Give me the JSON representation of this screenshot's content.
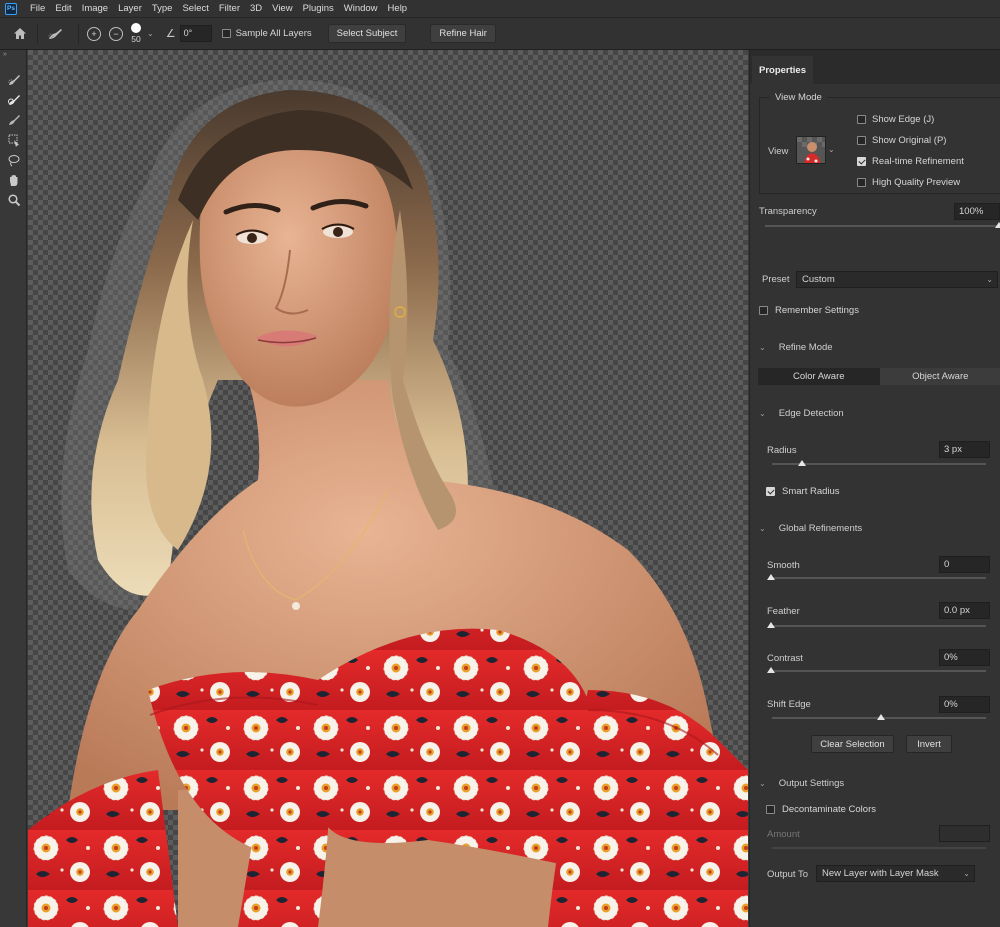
{
  "app": {
    "logo_text": "Ps"
  },
  "menu": [
    "File",
    "Edit",
    "Image",
    "Layer",
    "Type",
    "Select",
    "Filter",
    "3D",
    "View",
    "Plugins",
    "Window",
    "Help"
  ],
  "options_bar": {
    "brush_size": "50",
    "angle": "0°",
    "sample_all_layers": {
      "label": "Sample All Layers",
      "checked": false
    },
    "select_subject": "Select Subject",
    "refine_hair": "Refine Hair"
  },
  "tools": [
    "quick-selection-tool",
    "refine-edge-brush-tool",
    "brush-tool",
    "object-selection-tool",
    "lasso-tool",
    "hand-tool",
    "zoom-tool"
  ],
  "properties": {
    "tab": "Properties",
    "view_mode": {
      "title": "View Mode",
      "view_label": "View",
      "options": [
        {
          "label": "Show Edge (J)",
          "checked": false
        },
        {
          "label": "Show Original (P)",
          "checked": false
        },
        {
          "label": "Real-time Refinement",
          "checked": true
        },
        {
          "label": "High Quality Preview",
          "checked": false
        }
      ]
    },
    "transparency": {
      "label": "Transparency",
      "value": "100%",
      "level": 1.0
    },
    "preset": {
      "label": "Preset",
      "value": "Custom"
    },
    "remember_settings": {
      "label": "Remember Settings",
      "checked": false
    },
    "refine_mode": {
      "title": "Refine Mode",
      "options": [
        "Color Aware",
        "Object Aware"
      ],
      "selected": "Color Aware"
    },
    "edge_detection": {
      "title": "Edge Detection",
      "radius": {
        "label": "Radius",
        "value": "3 px",
        "level": 0.17
      },
      "smart_radius": {
        "label": "Smart Radius",
        "checked": true
      }
    },
    "global_refinements": {
      "title": "Global Refinements",
      "smooth": {
        "label": "Smooth",
        "value": "0",
        "level": 0
      },
      "feather": {
        "label": "Feather",
        "value": "0.0 px",
        "level": 0
      },
      "contrast": {
        "label": "Contrast",
        "value": "0%",
        "level": 0
      },
      "shift_edge": {
        "label": "Shift Edge",
        "value": "0%",
        "level": 0.5
      },
      "clear_selection": "Clear Selection",
      "invert": "Invert"
    },
    "output_settings": {
      "title": "Output Settings",
      "decontaminate": {
        "label": "Decontaminate Colors",
        "checked": false
      },
      "amount": {
        "label": "Amount",
        "value": ""
      },
      "output_to_label": "Output To",
      "output_to_value": "New Layer with Layer Mask"
    }
  },
  "colors": {
    "dress_red": "#e0262a",
    "skin": "#d9a07a",
    "hair": "#c9a57a",
    "panel_bg": "#333333"
  }
}
